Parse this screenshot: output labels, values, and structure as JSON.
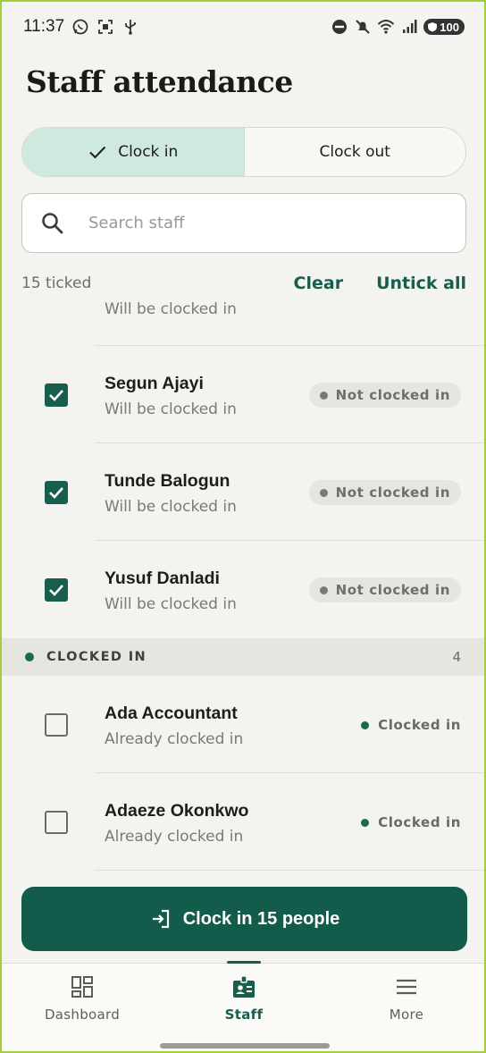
{
  "status_bar": {
    "time": "11:37",
    "battery": "100",
    "left_icons": [
      "whatsapp-icon",
      "screenshot-icon",
      "usb-icon"
    ],
    "right_icons": [
      "dnd-icon",
      "mute-icon",
      "wifi-icon",
      "signal-icon"
    ]
  },
  "page": {
    "title": "Staff attendance"
  },
  "mode_toggle": {
    "clock_in_label": "Clock in",
    "clock_out_label": "Clock out",
    "selected": "Clock in"
  },
  "search": {
    "placeholder": "Search staff",
    "value": ""
  },
  "selection": {
    "ticked_label": "15 ticked",
    "clear_label": "Clear",
    "untick_all_label": "Untick all"
  },
  "list": {
    "partial_sub": "Will be clocked in",
    "not_clocked": [
      {
        "name": "Segun Ajayi",
        "sub": "Will be clocked in",
        "status": "Not clocked in",
        "checked": true
      },
      {
        "name": "Tunde Balogun",
        "sub": "Will be clocked in",
        "status": "Not clocked in",
        "checked": true
      },
      {
        "name": "Yusuf Danladi",
        "sub": "Will be clocked in",
        "status": "Not clocked in",
        "checked": true
      }
    ],
    "section": {
      "label": "CLOCKED IN",
      "count": "4"
    },
    "clocked": [
      {
        "name": "Ada Accountant",
        "sub": "Already clocked in",
        "status": "Clocked in",
        "checked": false
      },
      {
        "name": "Adaeze Okonkwo",
        "sub": "Already clocked in",
        "status": "Clocked in",
        "checked": false
      }
    ]
  },
  "cta": {
    "label": "Clock in 15 people",
    "icon": "login-icon"
  },
  "bottom_nav": {
    "items": [
      {
        "label": "Dashboard",
        "icon": "dashboard-icon",
        "active": false
      },
      {
        "label": "Staff",
        "icon": "badge-icon",
        "active": true
      },
      {
        "label": "More",
        "icon": "menu-icon",
        "active": false
      }
    ]
  },
  "colors": {
    "primary": "#175e4d",
    "selected_segment": "#cfe9df",
    "background": "#f3f3ef",
    "clocked_dot": "#1e6a48"
  }
}
